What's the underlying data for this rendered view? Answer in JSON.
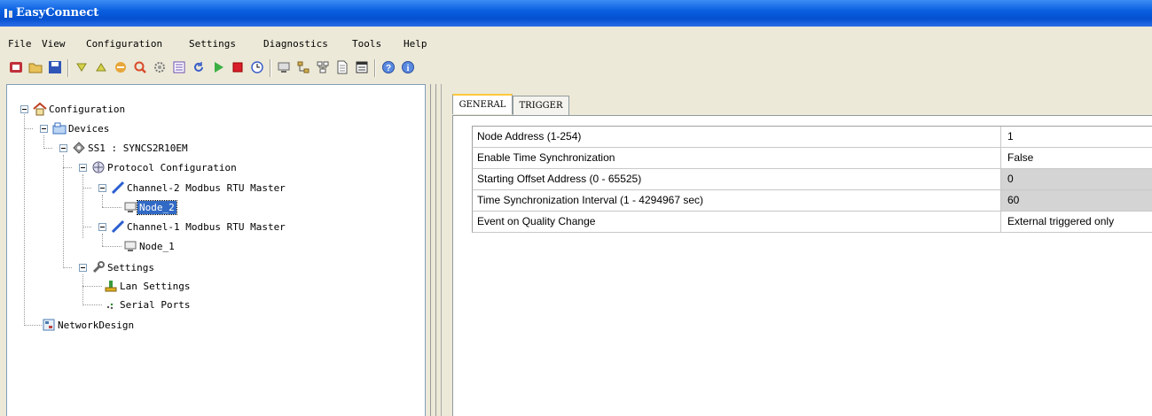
{
  "window": {
    "title": "EasyConnect"
  },
  "menu": [
    "File",
    "View",
    "Configuration",
    "Settings",
    "Diagnostics",
    "Tools",
    "Help"
  ],
  "toolbar": {
    "icons": [
      "new-icon",
      "open-icon",
      "save-icon",
      "download-icon",
      "upload-icon",
      "connect-icon",
      "search-icon",
      "settings-gear-icon",
      "list-icon",
      "refresh-icon",
      "run-icon",
      "stop-icon",
      "clock-icon",
      "monitor-icon",
      "tree-icon",
      "network-icon",
      "document-icon",
      "report-icon",
      "help-icon",
      "about-icon"
    ]
  },
  "tree": {
    "configuration": "Configuration",
    "devices": "Devices",
    "device_ss1": "SS1 : SYNCS2R10EM",
    "protocol_configuration": "Protocol Configuration",
    "channel2": "Channel-2 Modbus RTU Master",
    "node2": "Node_2",
    "channel1": "Channel-1 Modbus RTU Master",
    "node1": "Node_1",
    "settings": "Settings",
    "lan_settings": "Lan Settings",
    "serial_ports": "Serial Ports",
    "network_design": "NetworkDesign"
  },
  "tabs": {
    "general": "GENERAL",
    "trigger": "TRIGGER"
  },
  "properties": [
    {
      "name": "Node Address (1-254)",
      "value": "1",
      "readonly": false
    },
    {
      "name": "Enable Time Synchronization",
      "value": "False",
      "readonly": false
    },
    {
      "name": "Starting Offset Address (0 - 65525)",
      "value": "0",
      "readonly": true
    },
    {
      "name": "Time Synchronization Interval (1 - 4294967 sec)",
      "value": "60",
      "readonly": true
    },
    {
      "name": "Event on Quality Change",
      "value": "External triggered only",
      "readonly": false
    }
  ],
  "colors": {
    "titlebar": "#0a5fe0",
    "selection": "#316ac5",
    "tab_highlight": "#ffc83c"
  }
}
